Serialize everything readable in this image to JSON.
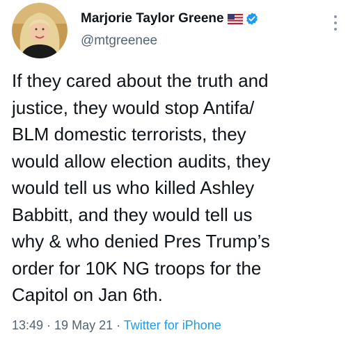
{
  "tweet": {
    "author": {
      "display_name": "Marjorie Taylor Greene",
      "handle": "@mtgreenee",
      "badges": [
        "us-flag-icon",
        "verified-icon"
      ]
    },
    "text_lines": [
      "If they cared about the truth and",
      "justice, they would stop Antifa/",
      "BLM domestic terrorists, they",
      "would allow election audits, they",
      "would tell us who killed Ashley",
      "Babbitt, and they would tell us",
      "why & who denied Pres Trump’s",
      "order for 10K NG troops for the",
      "Capitol on Jan 6th."
    ],
    "meta": {
      "time": "13:49",
      "separator": " · ",
      "date": "19 May 21",
      "source": "Twitter for iPhone"
    },
    "menu_icon": "more-vertical-icon"
  },
  "colors": {
    "text": "#0f1419",
    "secondary": "#536471",
    "accent": "#1d9bf0"
  }
}
